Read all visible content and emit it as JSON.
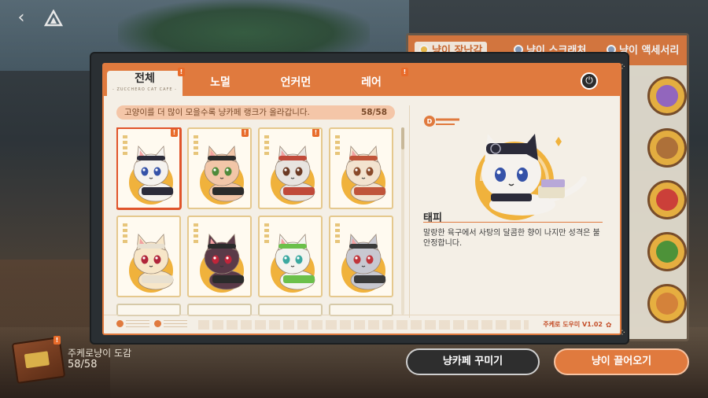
{
  "tabs": [
    {
      "label": "전체",
      "sub": "- ZUCCHERO CAT CAFE -",
      "selected": true,
      "badge": "!"
    },
    {
      "label": "노멀",
      "selected": false
    },
    {
      "label": "언커먼",
      "selected": false
    },
    {
      "label": "레어",
      "selected": false,
      "badge": "!"
    }
  ],
  "info_bar": {
    "text": "고양이를 더 많이 모을수록 냥카페 랭크가 올라갑니다.",
    "count": "58/58"
  },
  "cats": [
    {
      "fur": "#f5f2ee",
      "accent": "#2b2b3a",
      "eyes": "#3552a8",
      "selected": true,
      "badge": "!"
    },
    {
      "fur": "#f2c6a8",
      "accent": "#2b2b2b",
      "eyes": "#4f8a3a",
      "selected": false,
      "badge": "!"
    },
    {
      "fur": "#e8e4e0",
      "accent": "#c04a3a",
      "eyes": "#6b3a24",
      "selected": false,
      "badge": "!"
    },
    {
      "fur": "#f3e3cf",
      "accent": "#c0553a",
      "eyes": "#8a4a2a",
      "selected": false,
      "badge": ""
    },
    {
      "fur": "#f7e6c8",
      "accent": "#e8e0d0",
      "eyes": "#b0253a",
      "selected": false,
      "badge": ""
    },
    {
      "fur": "#5a3a48",
      "accent": "#2b2b2b",
      "eyes": "#c0253a",
      "selected": false,
      "badge": ""
    },
    {
      "fur": "#f3f3ef",
      "accent": "#6bc04a",
      "eyes": "#3aa8a0",
      "selected": false,
      "badge": ""
    },
    {
      "fur": "#c8c8d0",
      "accent": "#3a3a3a",
      "eyes": "#c0353a",
      "selected": false,
      "badge": ""
    }
  ],
  "detail": {
    "name": "태피",
    "description": "말랑한 육구에서 사탕의 달콤한 향이 나지만 성격은 불안정합니다."
  },
  "footer": {
    "version": "주케로 도우미 V1.02"
  },
  "side_panel": {
    "tabs": [
      "냥이 장난감",
      "냥이 스크래처",
      "냥이 액세서리"
    ]
  },
  "collection": {
    "title": "주케로냥이 도감",
    "count": "58/58",
    "badge": "!"
  },
  "buttons": {
    "decorate": "냥카페 꾸미기",
    "recruit": "냥이 끌어오기"
  },
  "colors": {
    "accent": "#e07a3e",
    "selected_border": "#e0542a",
    "card_circle": "#f0b23c"
  }
}
